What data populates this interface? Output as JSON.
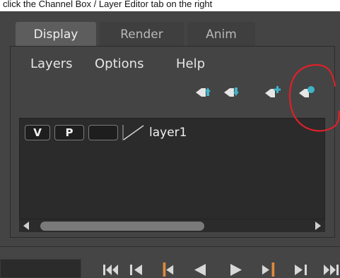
{
  "caption": {
    "text": "click the Channel Box / Layer Editor tab on the right"
  },
  "tabs": [
    {
      "label": "Display",
      "active": true
    },
    {
      "label": "Render",
      "active": false
    },
    {
      "label": "Anim",
      "active": false
    }
  ],
  "menu": {
    "items": [
      "Layers",
      "Options",
      "Help"
    ]
  },
  "toolbar": {
    "icons": [
      "move-layer-up-icon",
      "move-layer-down-icon",
      "create-empty-layer-icon",
      "create-layer-from-selected-icon"
    ],
    "accent_color": "#3fb4c8",
    "annotation_color": "#e0202a"
  },
  "layers": [
    {
      "visible_label": "V",
      "playback_label": "P",
      "reference_label": "",
      "name": "layer1"
    }
  ],
  "playback": {
    "icons": [
      "go-to-start-icon",
      "step-back-key-icon",
      "step-back-frame-icon",
      "play-backwards-icon",
      "play-forwards-icon",
      "step-forward-frame-icon",
      "step-forward-key-icon",
      "go-to-end-icon"
    ],
    "key_color": "#e08a3c"
  }
}
